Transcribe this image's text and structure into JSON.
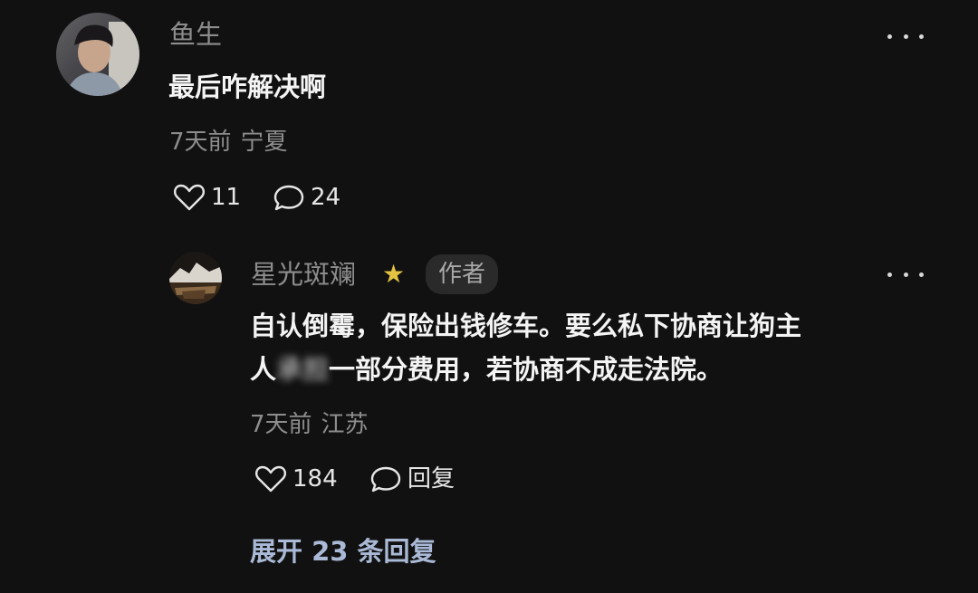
{
  "comment": {
    "avatar_icon": "user-avatar-photo",
    "username": "鱼生",
    "text": "最后咋解决啊",
    "time": "7天前",
    "location": "宁夏",
    "likes": "11",
    "replies_count": "24"
  },
  "reply": {
    "avatar_icon": "landscape-avatar-photo",
    "username": "星光斑斓",
    "badge_icon": "star-icon",
    "author_tag": "作者",
    "text_line1": "自认倒霉，保险出钱修车。要么私下协商让狗主",
    "text_line2_a": "人",
    "text_line2_blurred": "承担",
    "text_line2_b": "一部分费用，若协商不成走法院。",
    "time": "7天前",
    "location": "江苏",
    "likes": "184",
    "reply_label": "回复"
  },
  "expand_label": "展开 23 条回复",
  "colors": {
    "background": "#111111",
    "muted_text": "#8d8d8d",
    "expand_link": "#a9b9d6",
    "star": "#e3c341"
  }
}
